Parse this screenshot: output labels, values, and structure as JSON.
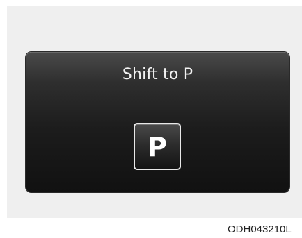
{
  "display": {
    "message": "Shift to P",
    "gear_indicator": "P"
  },
  "figure_code": "ODH043210L",
  "colors": {
    "display_background": "#1c1c1c",
    "text": "#f2f2f2",
    "frame_background": "#efefef",
    "gear_border": "#e8e8e8"
  }
}
